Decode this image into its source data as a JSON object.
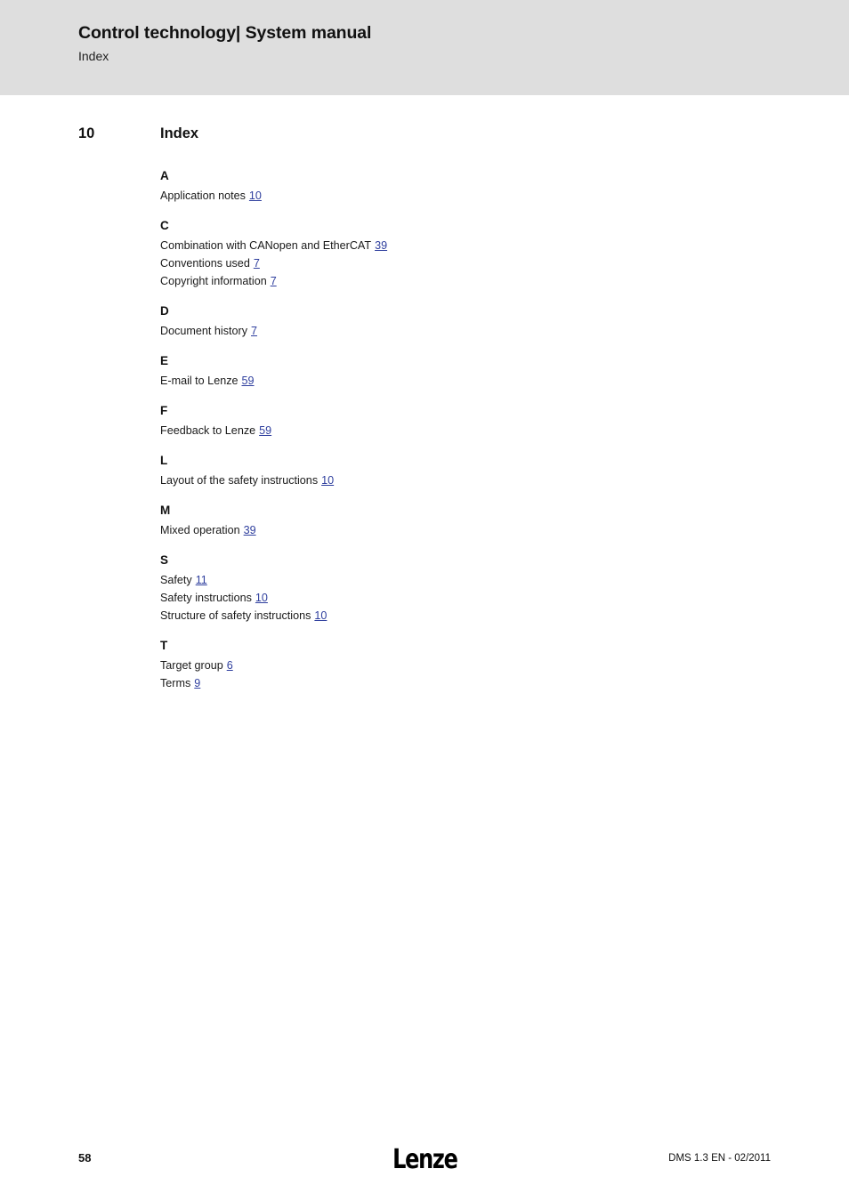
{
  "header": {
    "title": "Control technology| System manual",
    "subtitle": "Index",
    "background_color": "#dedede"
  },
  "chapter": {
    "number": "10",
    "title": "Index"
  },
  "colors": {
    "link": "#2f3f9e",
    "text": "#1a1a1a",
    "header_band": "#dedede"
  },
  "index": {
    "groups": [
      {
        "letter": "A",
        "entries": [
          {
            "label": "Application notes",
            "page": "10"
          }
        ]
      },
      {
        "letter": "C",
        "entries": [
          {
            "label": "Combination with CANopen and EtherCAT",
            "page": "39"
          },
          {
            "label": "Conventions used",
            "page": "7"
          },
          {
            "label": "Copyright information",
            "page": "7"
          }
        ]
      },
      {
        "letter": "D",
        "entries": [
          {
            "label": "Document history",
            "page": "7"
          }
        ]
      },
      {
        "letter": "E",
        "entries": [
          {
            "label": "E-mail to Lenze",
            "page": "59"
          }
        ]
      },
      {
        "letter": "F",
        "entries": [
          {
            "label": "Feedback to Lenze",
            "page": "59"
          }
        ]
      },
      {
        "letter": "L",
        "entries": [
          {
            "label": "Layout of the safety instructions",
            "page": "10"
          }
        ]
      },
      {
        "letter": "M",
        "entries": [
          {
            "label": "Mixed operation",
            "page": "39"
          }
        ]
      },
      {
        "letter": "S",
        "entries": [
          {
            "label": "Safety",
            "page": "11"
          },
          {
            "label": "Safety instructions",
            "page": "10"
          },
          {
            "label": "Structure of safety instructions",
            "page": "10"
          }
        ]
      },
      {
        "letter": "T",
        "entries": [
          {
            "label": "Target group",
            "page": "6"
          },
          {
            "label": "Terms",
            "page": "9"
          }
        ]
      }
    ]
  },
  "footer": {
    "page_number": "58",
    "logo_text": "Lenze",
    "document_id": "DMS 1.3 EN - 02/2011"
  }
}
